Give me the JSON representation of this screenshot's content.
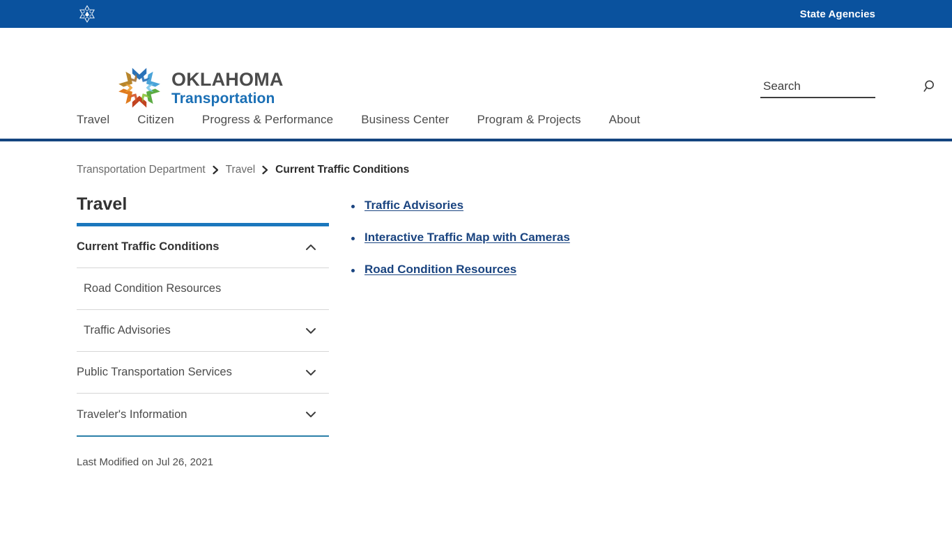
{
  "topbar": {
    "logo_icon": "oklahoma-star-icon",
    "state_agencies_label": "State Agencies"
  },
  "header": {
    "brand": {
      "logo_icon": "oklahoma-pinwheel-logo",
      "line1": "OKLAHOMA",
      "line2": "Transportation"
    },
    "search": {
      "placeholder": "Search",
      "value": "",
      "icon": "search-icon"
    }
  },
  "nav": {
    "items": [
      {
        "label": "Travel"
      },
      {
        "label": "Citizen"
      },
      {
        "label": "Progress & Performance"
      },
      {
        "label": "Business Center"
      },
      {
        "label": "Program & Projects"
      },
      {
        "label": "About"
      }
    ]
  },
  "breadcrumb": {
    "items": [
      {
        "label": "Transportation Department",
        "current": false
      },
      {
        "label": "Travel",
        "current": false
      },
      {
        "label": "Current Traffic Conditions",
        "current": true
      }
    ],
    "separator_icon": "chevron-right-icon"
  },
  "sidebar": {
    "title": "Travel",
    "items": [
      {
        "label": "Current Traffic Conditions",
        "state": "expanded",
        "icon": "chevron-up-icon",
        "level": 0,
        "active": true
      },
      {
        "label": "Road Condition Resources",
        "state": "leaf",
        "icon": "",
        "level": 1,
        "active": false
      },
      {
        "label": "Traffic Advisories",
        "state": "collapsed",
        "icon": "chevron-down-icon",
        "level": 1,
        "active": false
      },
      {
        "label": "Public Transportation Services",
        "state": "collapsed",
        "icon": "chevron-down-icon",
        "level": 0,
        "active": false
      },
      {
        "label": "Traveler's Information",
        "state": "collapsed",
        "icon": "chevron-down-icon",
        "level": 0,
        "active": false
      }
    ],
    "last_modified": "Last Modified on Jul 26, 2021"
  },
  "main": {
    "links": [
      {
        "label": "Traffic Advisories"
      },
      {
        "label": "Interactive Traffic Map with Cameras"
      },
      {
        "label": "Road Condition Resources"
      }
    ]
  },
  "colors": {
    "topbar_blue": "#0a529e",
    "nav_border_navy": "#14447f",
    "sidebar_accent_blue": "#1a77bd",
    "sidebar_bottom_teal": "#2b7fa8",
    "link_navy": "#1a4480",
    "brand_blue": "#1a6fb5",
    "brand_gray": "#4c4c4c"
  }
}
